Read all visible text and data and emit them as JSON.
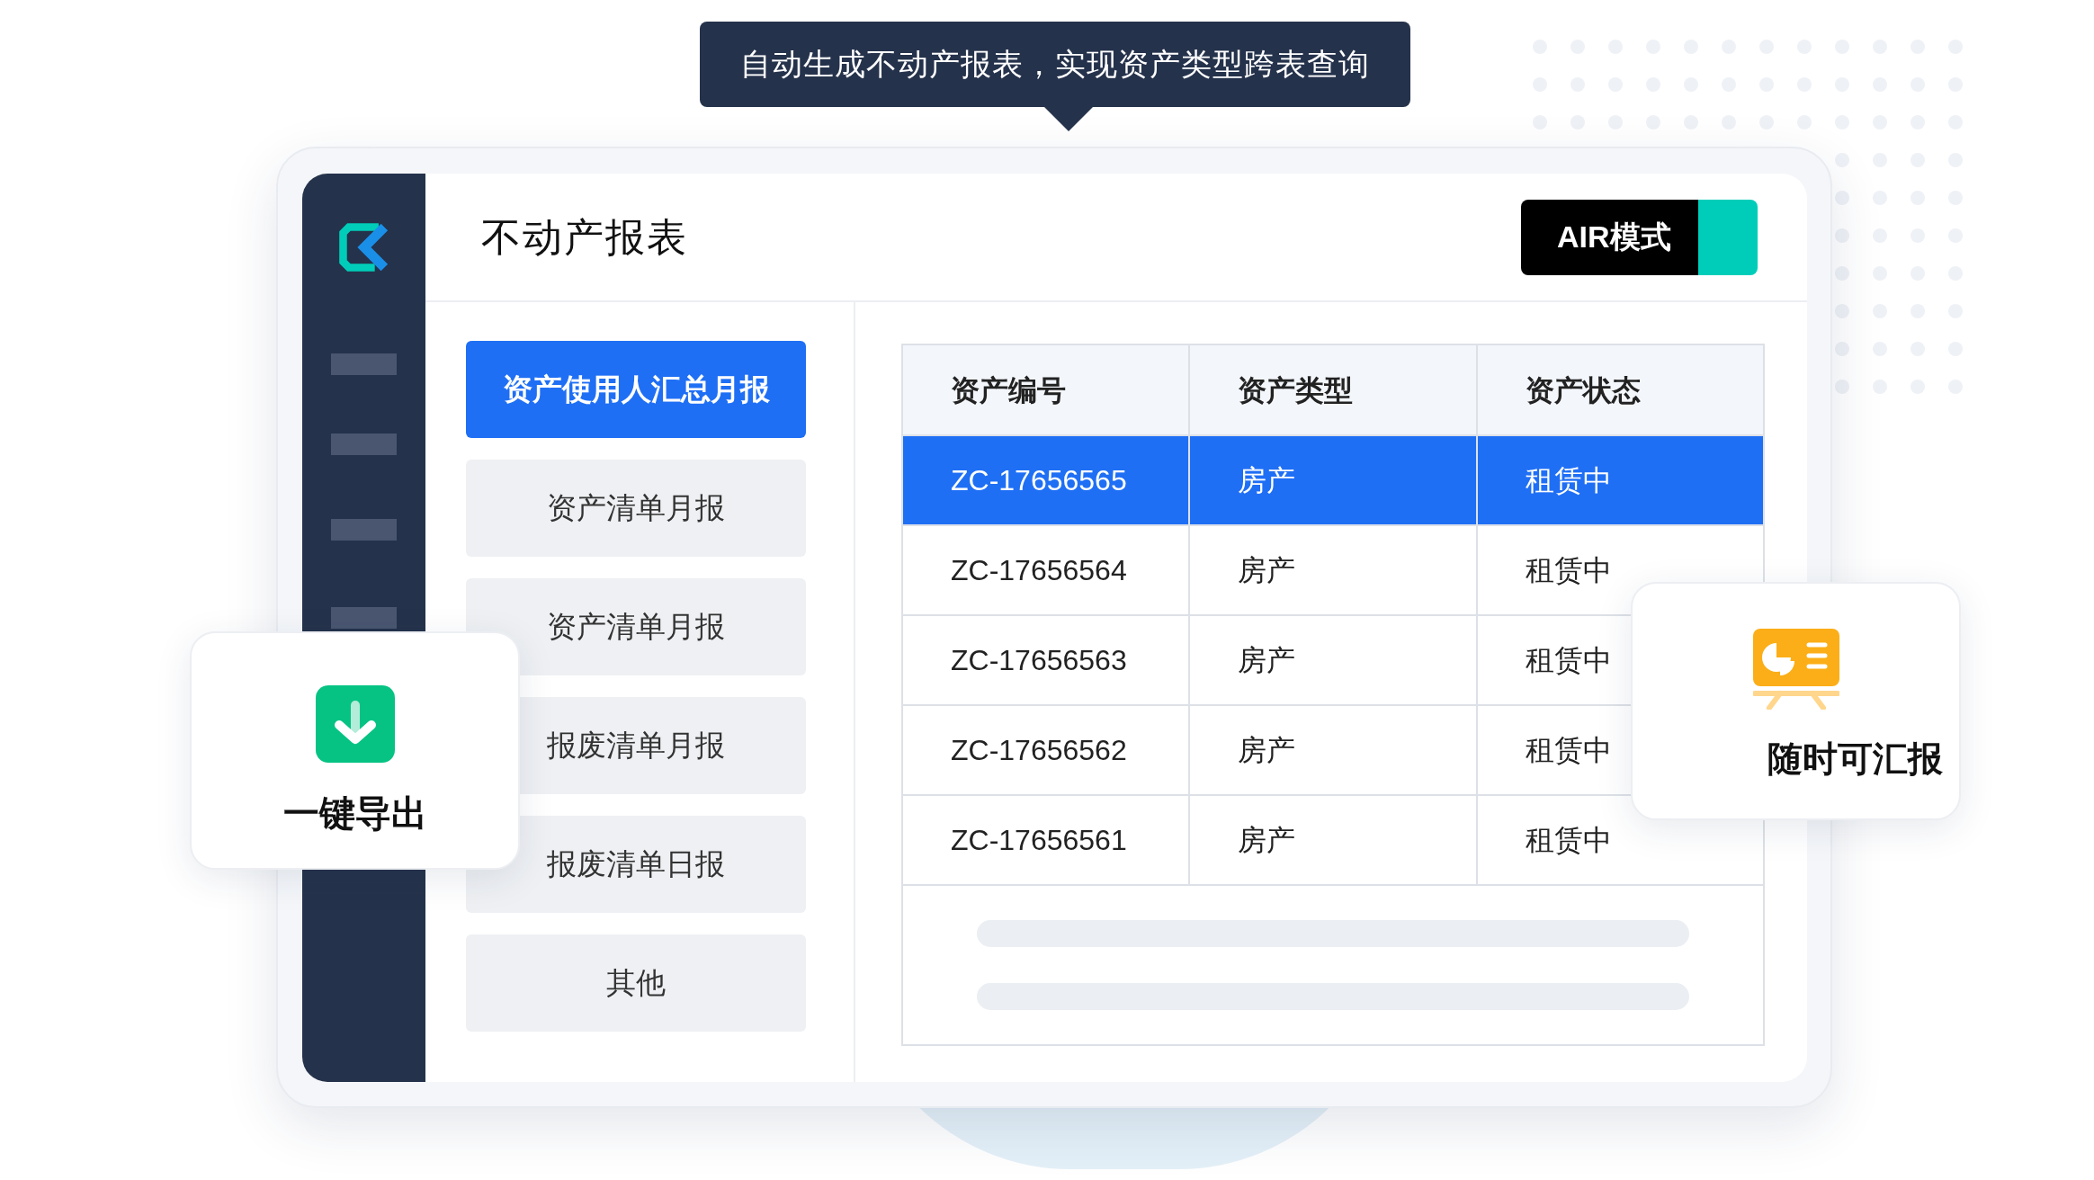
{
  "tooltip": {
    "text": "自动生成不动产报表，实现资产类型跨表查询"
  },
  "app": {
    "title": "不动产报表",
    "mode_button": {
      "label": "AIR模式"
    }
  },
  "report_menu": [
    {
      "label": "资产使用人汇总月报",
      "selected": true
    },
    {
      "label": "资产清单月报",
      "selected": false
    },
    {
      "label": "资产清单月报",
      "selected": false
    },
    {
      "label": "报废清单月报",
      "selected": false
    },
    {
      "label": "报废清单日报",
      "selected": false
    },
    {
      "label": "其他",
      "selected": false
    }
  ],
  "table": {
    "columns": [
      "资产编号",
      "资产类型",
      "资产状态"
    ],
    "rows": [
      {
        "cells": [
          "ZC-17656565",
          "房产",
          "租赁中"
        ],
        "selected": true
      },
      {
        "cells": [
          "ZC-17656564",
          "房产",
          "租赁中"
        ],
        "selected": false
      },
      {
        "cells": [
          "ZC-17656563",
          "房产",
          "租赁中"
        ],
        "selected": false
      },
      {
        "cells": [
          "ZC-17656562",
          "房产",
          "租赁中"
        ],
        "selected": false
      },
      {
        "cells": [
          "ZC-17656561",
          "房产",
          "租赁中"
        ],
        "selected": false
      }
    ]
  },
  "export_card": {
    "label": "一键导出"
  },
  "report_card": {
    "label": "随时可汇报"
  }
}
